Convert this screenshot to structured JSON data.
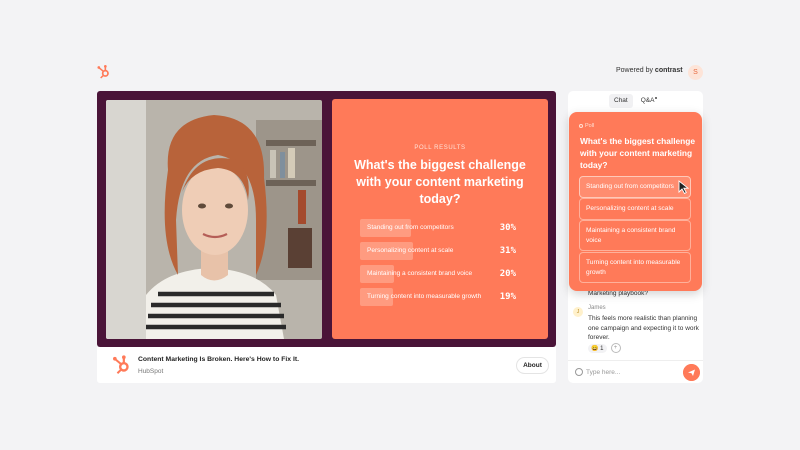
{
  "header": {
    "powered_prefix": "Powered by",
    "powered_brand": "contrast",
    "user_initial": "S"
  },
  "stage": {
    "poll_results": {
      "kicker": "POLL RESULTS",
      "question": "What's the biggest challenge with your content marketing today?",
      "results": [
        {
          "label": "Standing out from competitors",
          "percent": 30,
          "display": "30%"
        },
        {
          "label": "Personalizing content at scale",
          "percent": 31,
          "display": "31%"
        },
        {
          "label": "Maintaining a consistent brand voice",
          "percent": 20,
          "display": "20%"
        },
        {
          "label": "Turning content into measurable growth",
          "percent": 19,
          "display": "19%"
        }
      ]
    }
  },
  "session": {
    "title": "Content Marketing Is Broken. Here's How to Fix It.",
    "host": "HubSpot",
    "about_label": "About"
  },
  "chat": {
    "tabs": [
      {
        "label": "Chat",
        "active": true
      },
      {
        "label": "Q&A",
        "active": false
      }
    ],
    "previous_message_tail": "Marketing playbook?",
    "message": {
      "avatar_initial": "J",
      "author": "James",
      "text": "This feels more realistic than planning one campaign and expecting it to work forever."
    },
    "reaction": {
      "emoji": "😄",
      "count": "1"
    },
    "composer_placeholder": "Type here..."
  },
  "poll": {
    "tag": "Poll",
    "question": "What's the biggest challenge with your content marketing today?",
    "options": [
      "Standing out from competitors",
      "Personalizing content at scale",
      "Maintaining a consistent brand voice",
      "Turning content into measurable growth"
    ]
  },
  "colors": {
    "brand_orange": "#ff7a59",
    "stage_plum": "#4a1438",
    "background": "#f3f3f5"
  },
  "icons": [
    "hubspot-logo-icon",
    "emoji-icon",
    "send-icon",
    "add-reaction-icon",
    "cursor-icon"
  ]
}
